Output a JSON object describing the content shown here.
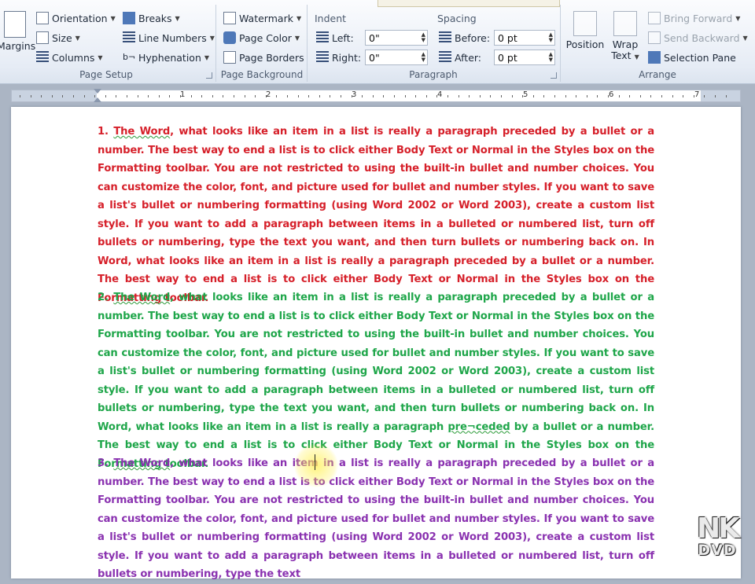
{
  "ribbon": {
    "page_setup": {
      "label": "Page Setup",
      "margins": "Margins",
      "orientation": "Orientation",
      "size": "Size",
      "columns": "Columns",
      "breaks": "Breaks",
      "line_numbers": "Line Numbers",
      "hyphenation": "Hyphenation"
    },
    "page_background": {
      "label": "Page Background",
      "watermark": "Watermark",
      "page_color": "Page Color",
      "page_borders": "Page Borders"
    },
    "paragraph": {
      "label": "Paragraph",
      "indent": "Indent",
      "left": "Left:",
      "right": "Right:",
      "left_value": "0\"",
      "right_value": "0\"",
      "spacing": "Spacing",
      "before": "Before:",
      "after": "After:",
      "before_value": "0 pt",
      "after_value": "0 pt"
    },
    "arrange": {
      "label": "Arrange",
      "position": "Position",
      "wrap_text_1": "Wrap",
      "wrap_text_2": "Text",
      "bring_forward": "Bring Forward",
      "send_backward": "Send Backward",
      "selection_pane": "Selection Pane"
    }
  },
  "ruler": {
    "numbers": [
      "1",
      "2",
      "3",
      "4",
      "5",
      "6",
      "7"
    ]
  },
  "document": {
    "p1": {
      "num": "1. ",
      "the_word": "The Word",
      "body": ", what looks like an item in a list is really a paragraph preceded by a bullet or a number. The best way to end a list is to click either Body Text or Normal in the Styles box on the Formatting toolbar.    You are not restricted to using the built-in bullet and number choices. You can customize the color, font, and picture used for bullet and number styles. If you want to save a list's bullet or numbering formatting (using Word 2002 or Word 2003), create a custom list style. If you want to add a paragraph between items in a bulleted or numbered list, turn off bullets or numbering, type the text you want, and then turn bullets or numbering back on.    In Word, what looks like an item in a list is really a paragraph preceded by a bullet or a number.  The best way to end a list is to click either Body Text or Normal in the Styles box on the Formatting toolbar."
    },
    "p2": {
      "num": "2. ",
      "the_word": "The Word",
      "body_a": ", what looks like an item in a list is really a paragraph preceded by a bullet or a number. The best way to end a list is to click either Body Text or Normal in the Styles box on the Formatting toolbar.    You are not restricted to using the built-in bullet and number choices. You can customize the color, font, and picture used for bullet and number styles. If you want to save a list's bullet or numbering formatting (using Word 2002 or Word 2003), create a custom list style. If you want to add a paragraph between items in a bulleted or numbered list, turn off bullets or numbering, type the text you want, and then turn bullets or numbering back on.    In Word, what looks like an item in a list is really a paragraph ",
      "preceded": "pre¬ceded",
      "body_b": " by a bullet or a number.  The best way to end a list is to click either Body Text or Normal in the Styles box on the Formatting toolbar."
    },
    "p3": {
      "num": "3. ",
      "the_word": "The Word",
      "body": ", what looks like an item in a list is really a paragraph preceded by a bullet or a number. The best way to end a list is to click either Body Text or Normal in the Styles box on the Formatting toolbar.    You are not restricted to using the built-in bullet and number choices. You can customize the color, font, and picture used for bullet and number styles. If you want to save a list's bullet or numbering formatting (using Word 2002 or Word 2003), create a custom list style. If you want to add a paragraph between items in a bulleted or numbered list, turn off bullets or numbering, type the text"
    }
  },
  "watermark_logo": {
    "line1": "NK",
    "line2": "DVD"
  },
  "colors": {
    "red": "#d6202a",
    "green": "#1fa64a",
    "purple": "#8a32b0"
  }
}
